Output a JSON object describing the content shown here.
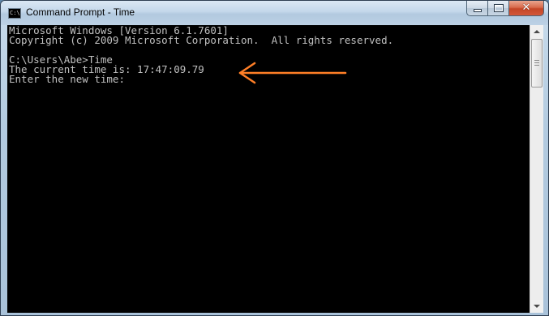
{
  "window": {
    "title": "Command Prompt - Time",
    "icon_label": "C:\\",
    "close_glyph": "✕"
  },
  "console": {
    "lines": [
      "Microsoft Windows [Version 6.1.7601]",
      "Copyright (c) 2009 Microsoft Corporation.  All rights reserved.",
      "",
      "C:\\Users\\Abe>Time",
      "The current time is: 17:47:09.79",
      "Enter the new time:"
    ],
    "text_color": "#c0c0c0",
    "background_color": "#000000"
  },
  "annotation": {
    "icon": "arrow-left-icon",
    "color": "#ff7f27"
  }
}
